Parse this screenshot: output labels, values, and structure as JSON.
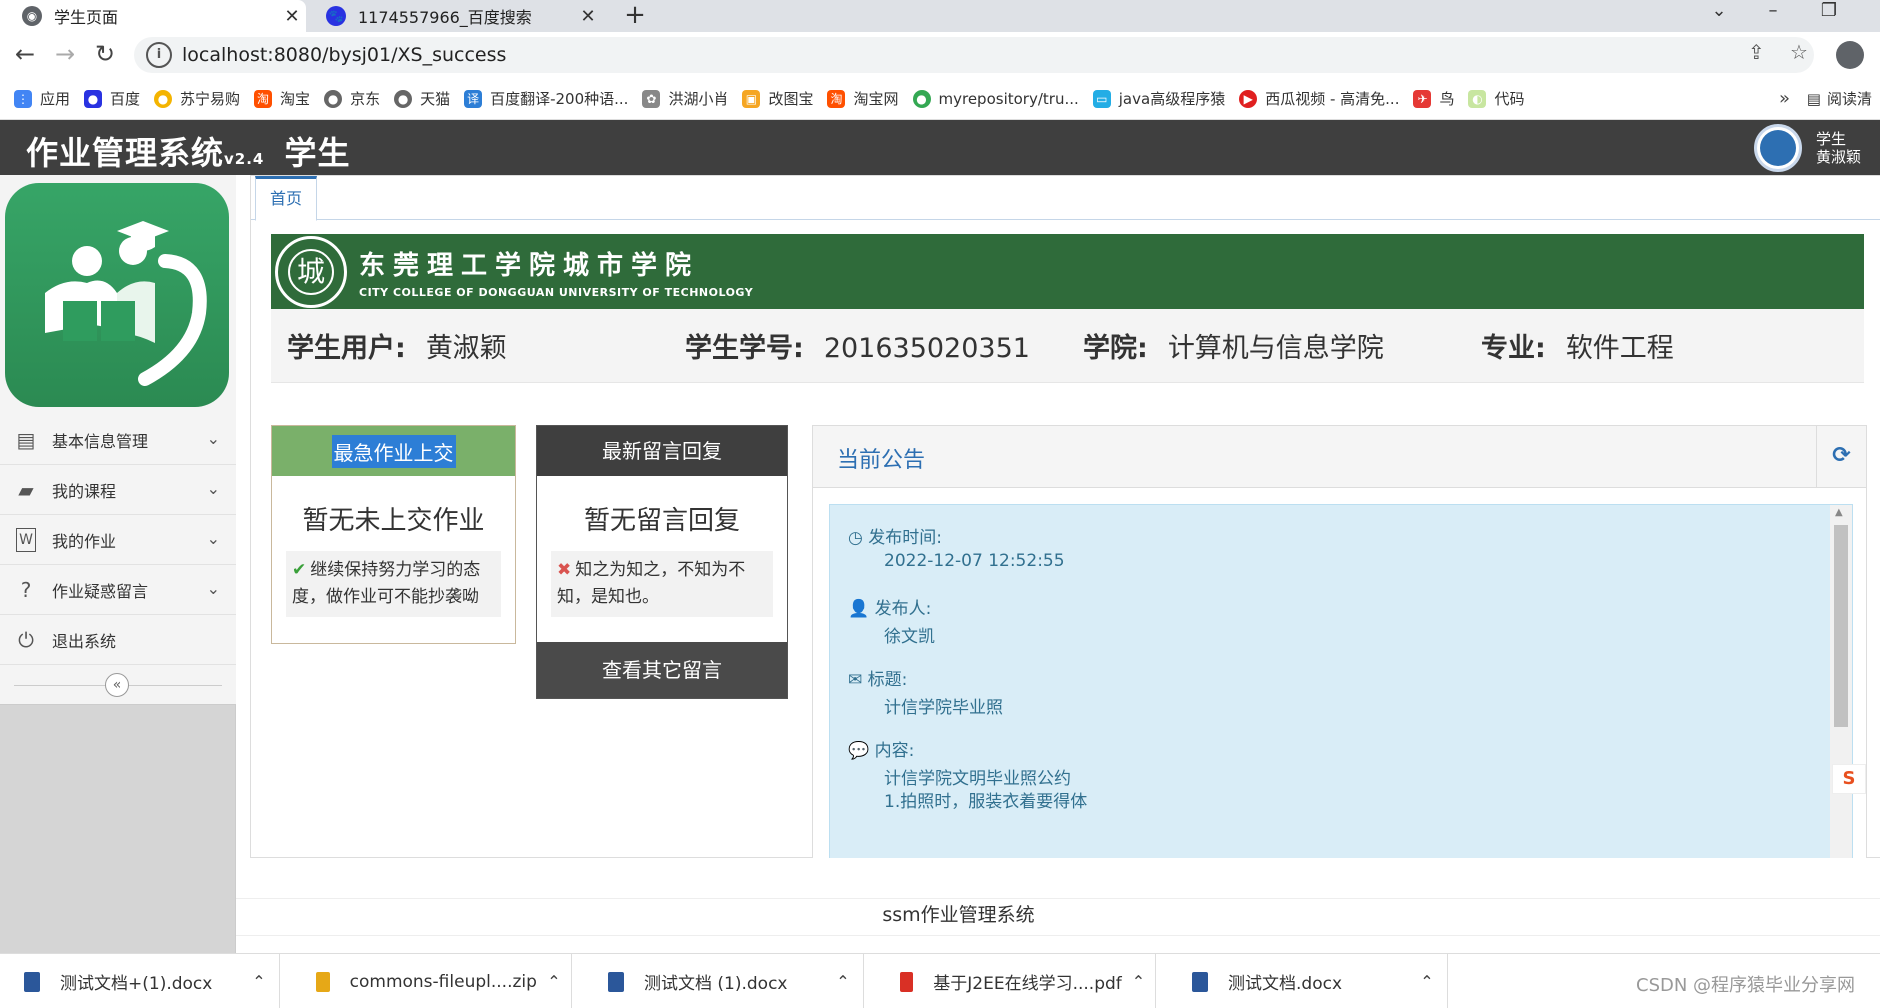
{
  "browser": {
    "tabs": [
      {
        "title": "学生页面",
        "active": true
      },
      {
        "title": "1174557966_百度搜索",
        "active": false
      }
    ],
    "url": "localhost:8080/bysj01/XS_success",
    "bookmarks": [
      {
        "label": "应用",
        "icon": "apps-grid-icon",
        "color": "#4285f4"
      },
      {
        "label": "百度",
        "icon": "baidu-paw-icon",
        "color": "#2932e1"
      },
      {
        "label": "苏宁易购",
        "icon": "suning-icon",
        "color": "#f4b400"
      },
      {
        "label": "淘宝",
        "icon": "taobao-icon",
        "color": "#ff5000"
      },
      {
        "label": "京东",
        "icon": "globe-icon",
        "color": "#666666"
      },
      {
        "label": "天猫",
        "icon": "globe-icon",
        "color": "#666666"
      },
      {
        "label": "百度翻译-200种语...",
        "icon": "translate-icon",
        "color": "#2d7ed6"
      },
      {
        "label": "洪湖小肖",
        "icon": "leaf-icon",
        "color": "#888888"
      },
      {
        "label": "改图宝",
        "icon": "image-icon",
        "color": "#f5a623"
      },
      {
        "label": "淘宝网",
        "icon": "taobao-icon",
        "color": "#ff5000"
      },
      {
        "label": "myrepository/tru...",
        "icon": "chrome-icon",
        "color": "#34a853"
      },
      {
        "label": "java高级程序猿",
        "icon": "bilibili-icon",
        "color": "#23ade5"
      },
      {
        "label": "西瓜视频 - 高清免...",
        "icon": "xigua-icon",
        "color": "#e02020"
      },
      {
        "label": "鸟",
        "icon": "bird-icon",
        "color": "#e53935"
      },
      {
        "label": "代码",
        "icon": "leaf-icon",
        "color": "#c8e6a0"
      }
    ],
    "bookmarks_more": "»",
    "reading_list": "阅读清"
  },
  "app": {
    "brand": "作业管理系统",
    "version": "v2.4",
    "role_title": "学生",
    "user_role": "学生",
    "user_name": "黄淑颖"
  },
  "sidebar": {
    "items": [
      {
        "label": "基本信息管理",
        "icon": "id-card-icon"
      },
      {
        "label": "我的课程",
        "icon": "book-icon"
      },
      {
        "label": "我的作业",
        "icon": "word-doc-icon"
      },
      {
        "label": "作业疑惑留言",
        "icon": "question-circle-icon"
      },
      {
        "label": "退出系统",
        "icon": "power-icon"
      }
    ],
    "collapse_symbol": "«"
  },
  "main": {
    "home_tab": "首页",
    "banner": {
      "cn": "东莞理工学院城市学院",
      "en": "CITY COLLEGE OF DONGGUAN UNIVERSITY OF TECHNOLOGY"
    },
    "student": {
      "user_label": "学生用户:",
      "user_value": "黄淑颖",
      "id_label": "学生学号:",
      "id_value": "201635020351",
      "college_label": "学院:",
      "college_value": "计算机与信息学院",
      "major_label": "专业:",
      "major_value": "软件工程"
    },
    "urgent_card": {
      "header": "最急作业上交",
      "big": "暂无未上交作业",
      "message": "继续保持努力学习的态度，做作业可不能抄袭呦"
    },
    "reply_card": {
      "header": "最新留言回复",
      "big": "暂无留言回复",
      "message": "知之为知之，不知为不知，是知也。",
      "footer_button": "查看其它留言"
    },
    "notice": {
      "title": "当前公告",
      "time_label": "发布时间:",
      "time_value": "2022-12-07 12:52:55",
      "author_label": "发布人:",
      "author_value": "徐文凯",
      "subject_label": "标题:",
      "subject_value": "计信学院毕业照",
      "content_label": "内容:",
      "content_line1": "计信学院文明毕业照公约",
      "content_line2": "1.拍照时，服装衣着要得体"
    },
    "footer": "ssm作业管理系统"
  },
  "downloads": [
    {
      "name": "测试文档+(1).docx",
      "type": "docx"
    },
    {
      "name": "commons-fileupl....zip",
      "type": "zip"
    },
    {
      "name": "测试文档 (1).docx",
      "type": "docx"
    },
    {
      "name": "基于J2EE在线学习....pdf",
      "type": "pdf"
    },
    {
      "name": "测试文档.docx",
      "type": "docx"
    }
  ],
  "watermark": "CSDN @程序猿毕业分享网",
  "colors": {
    "header_dark": "#3f3f3f",
    "accent_blue": "#2d6fb2",
    "banner_green": "#2f6b3a",
    "urgent_green": "#7ab06a",
    "notice_bg": "#d9edf7"
  }
}
